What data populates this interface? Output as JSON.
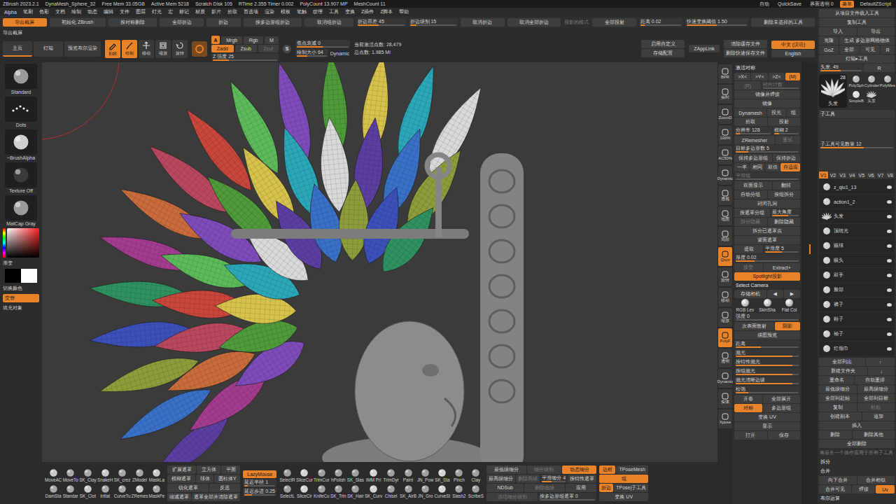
{
  "title_bar": {
    "items": [
      "ZBrush 2023.2.1",
      "DynaMesh_Sphere_32",
      "Free Mem 33.05GB",
      "Active Mem 5218",
      "Scratch Disk 105",
      "RTime 2.355 Timer 0.002",
      "PolyCount 13.907 MP",
      "MeshCount 11"
    ],
    "right": [
      {
        "label": "自动",
        "selected": false
      },
      {
        "label": "QuickSave",
        "selected": false
      },
      {
        "label": "界面透明 0",
        "selected": false
      },
      {
        "label": "菜单",
        "selected": true
      },
      {
        "label": "DefaultZScript",
        "selected": false
      }
    ]
  },
  "menu_bar": [
    "Alpha",
    "笔刷",
    "色彩",
    "文档",
    "绘制",
    "动态",
    "编辑",
    "文件",
    "图层",
    "灯光",
    "宏",
    "标记",
    "材质",
    "影片",
    "拾取",
    "首选项",
    "渲染",
    "模板",
    "笔触",
    "纹理",
    "工具",
    "变换",
    "Z插件",
    "Z脚本",
    "帮助"
  ],
  "shelf_row": [
    {
      "label": "导出截屏",
      "selected": true
    },
    {
      "label": "初始化 ZBrush"
    },
    {
      "label": "按对称删除"
    },
    {
      "label": "全部折边"
    },
    {
      "label": "折边"
    },
    {
      "label": "按多边形组折边"
    },
    {
      "label": "取消组折边"
    },
    {
      "label": "折边容差 45",
      "kind": "slider",
      "level": 0.45
    },
    {
      "label": "折边级别 15",
      "kind": "slider",
      "level": 0.15
    },
    {
      "label": "取消折边"
    },
    {
      "label": "取消全部折边"
    },
    {
      "label": "投影的模式",
      "kind": "text",
      "disabled": true
    },
    {
      "label": "全部投射"
    },
    {
      "label": "距离 0.02",
      "kind": "slider",
      "level": 0.1
    },
    {
      "label": "快速变换阈值 1.50",
      "kind": "slider",
      "level": 0.5
    },
    {
      "label": "删除未选择的工具"
    }
  ],
  "toolbar": {
    "caption": "导出截屏",
    "nav": [
      {
        "label": "主页",
        "selected": true
      },
      {
        "label": "灯箱",
        "selected": false
      },
      {
        "label": "预览布尔渲染",
        "selected": false
      }
    ],
    "modes": [
      {
        "label": "Edit",
        "selected": true
      },
      {
        "label": "绘制",
        "selected": true
      },
      {
        "label": "移动",
        "selected": false
      },
      {
        "label": "缩放",
        "selected": false
      },
      {
        "label": "旋转",
        "selected": false
      }
    ],
    "channel_a": {
      "label": "A",
      "selected": true
    },
    "channels": [
      {
        "label": "Mrgb",
        "selected": false
      },
      {
        "label": "Rgb",
        "selected": false
      },
      {
        "label": "M",
        "selected": false
      }
    ],
    "z_modes": [
      {
        "label": "Zadd",
        "selected": true,
        "disabled": false
      },
      {
        "label": "Zsub",
        "selected": false,
        "disabled": false
      },
      {
        "label": "Zcut",
        "selected": false,
        "disabled": true
      }
    ],
    "z_intensity": {
      "label": "Z 强度 25",
      "level": 0.25
    },
    "s_icon": "S",
    "focal": {
      "label": "焦点衰减 0",
      "level": 0.5
    },
    "draw_size": {
      "label": "绘制大小 64",
      "level": 0.35
    },
    "dynamic": "Dynamic",
    "stats": [
      "当前激活点数: 28,479",
      "总点数: 1.985 Mi"
    ],
    "config": [
      [
        {
          "label": "启用自定义"
        },
        {
          "label": "存储配置"
        }
      ],
      [
        {
          "label": "ZAppLink"
        }
      ],
      [
        {
          "label": "清除缓存文件"
        },
        {
          "label": "删除快速保存文件"
        }
      ],
      [
        {
          "label": "中文 (汉语)",
          "selected": true
        },
        {
          "label": "English",
          "selected": false
        }
      ]
    ]
  },
  "left_tray": {
    "brushes": [
      {
        "label": "Standard"
      },
      {
        "label": "Dots"
      },
      {
        "label": "~BrushAlpha"
      },
      {
        "label": "Texture Off"
      },
      {
        "label": "MatCap Gray"
      }
    ],
    "gradient": "渐变",
    "switch": "切换颜色",
    "alternate": {
      "label": "交替",
      "selected": true
    },
    "fill": "填充对象"
  },
  "shelf_column": [
    {
      "label": "BPR",
      "selected": false
    },
    {
      "label": "实时",
      "selected": false
    },
    {
      "label": "ZoomD",
      "selected": false
    },
    {
      "label": "100%",
      "selected": false
    },
    {
      "label": "AC50%",
      "selected": false
    },
    {
      "label": "Dynamic",
      "selected": false
    },
    {
      "label": "透视",
      "selected": false
    },
    {
      "label": "地面",
      "selected": false
    },
    {
      "label": "局部",
      "selected": false
    },
    {
      "label": "Qxyz",
      "selected": true
    },
    {
      "label": "旋转",
      "selected": false
    },
    {
      "label": "移动",
      "selected": false
    },
    {
      "label": "缩放",
      "selected": false
    },
    {
      "label": "PolyF",
      "selected": true
    },
    {
      "label": "透明",
      "selected": false
    },
    {
      "label": "Dynamic",
      "selected": false
    },
    {
      "label": "实体",
      "selected": false
    },
    {
      "label": "Xpose",
      "selected": false
    }
  ],
  "props_panel": [
    [
      {
        "label": "激活对称",
        "kind": "header"
      }
    ],
    [
      {
        "label": ">X<",
        "selected": false
      },
      {
        "label": ">Y<",
        "selected": false
      },
      {
        "label": ">Z<",
        "selected": false
      },
      {
        "label": "(M)",
        "selected": true
      }
    ],
    [
      {
        "label": "(R)",
        "disabled": true
      },
      {
        "label": "径向计数",
        "kind": "slider",
        "level": 0,
        "disabled": true
      }
    ],
    [
      {
        "label": "镜像并焊接"
      }
    ],
    [
      {
        "label": "镜像"
      }
    ],
    [
      {
        "label": "Dynamesh"
      },
      {
        "label": "投光"
      },
      {
        "label": "组"
      }
    ],
    [
      {
        "label": "拾取"
      },
      {
        "label": "投射"
      }
    ],
    [
      {
        "label": "分辨率 128",
        "kind": "slider",
        "level": 0.13
      },
      {
        "label": "模糊 2",
        "kind": "slider",
        "level": 0.2
      }
    ],
    [
      {
        "label": "ZRemesher"
      },
      {
        "label": "重试",
        "disabled": true
      }
    ],
    [
      {
        "label": "目标多边形数 5",
        "kind": "slider",
        "level": 0.2
      }
    ],
    [
      {
        "label": "保持多边形组"
      },
      {
        "label": "保持折边"
      }
    ],
    [
      {
        "label": "一半",
        "selected": false
      },
      {
        "label": "相同",
        "selected": false
      },
      {
        "label": "双倍",
        "selected": false
      },
      {
        "label": "自适应",
        "selected": true
      }
    ],
    [
      {
        "label": "平滑组",
        "kind": "slider",
        "level": 0,
        "disabled": true
      }
    ],
    [
      {
        "label": "双面显示"
      },
      {
        "label": "翻转"
      }
    ],
    [
      {
        "label": "自动分组"
      },
      {
        "label": "按组拆分"
      }
    ],
    [
      {
        "label": "封闭孔洞"
      }
    ],
    [
      {
        "label": "按遮罩分组"
      },
      {
        "label": "最大角度",
        "kind": "slider",
        "level": 0.6
      }
    ],
    [
      {
        "label": "拆分隐藏",
        "disabled": true
      },
      {
        "label": "删除隐藏"
      }
    ],
    [
      {
        "label": "拆分已遮罩点"
      }
    ],
    [
      {
        "label": "背面遮罩"
      }
    ],
    [
      {
        "label": "提取"
      },
      {
        "label": "平滑度 5",
        "kind": "slider",
        "level": 0.5
      }
    ],
    [
      {
        "label": "厚度 0.02",
        "kind": "slider",
        "level": 0.3
      }
    ],
    [
      {
        "label": "接受",
        "disabled": true
      },
      {
        "label": "Extract+"
      }
    ],
    [
      {
        "label": "Spotlight投影",
        "selected": true
      }
    ],
    [
      {
        "label": "Select Camera",
        "kind": "header"
      }
    ],
    [
      {
        "label": "存储相机"
      },
      {
        "label": "◀"
      },
      {
        "label": "▶"
      }
    ],
    [
      {
        "label": "RGB Lev",
        "kind": "swatch"
      },
      {
        "label": "SkinSha",
        "kind": "swatch"
      },
      {
        "label": "Flat Col",
        "kind": "swatch"
      }
    ],
    [
      {
        "label": "强度 0",
        "kind": "slider",
        "level": 0
      }
    ],
    [
      {
        "label": "次表面散射"
      },
      {
        "label": "阴影",
        "selected": true
      }
    ],
    [
      {
        "label": "描图预览"
      }
    ],
    [
      {
        "label": "距离",
        "kind": "slider",
        "level": 0.4
      }
    ],
    [
      {
        "label": "抛光",
        "kind": "slider",
        "level": 0.9
      }
    ],
    [
      {
        "label": "按特性抛光",
        "kind": "slider",
        "level": 0.9
      }
    ],
    [
      {
        "label": "按组抛光",
        "kind": "slider",
        "level": 0.9
      }
    ],
    [
      {
        "label": "抛光清晰边缘",
        "kind": "slider",
        "level": 0.9
      }
    ],
    [
      {
        "label": "松弛",
        "kind": "slider",
        "level": 0.2
      }
    ],
    [
      {
        "label": "开卷"
      },
      {
        "label": "全部展开"
      }
    ],
    [
      {
        "label": "对称",
        "selected": true
      },
      {
        "label": "多边形组",
        "selected": false
      }
    ],
    [
      {
        "label": "变换 UV"
      }
    ],
    [
      {
        "label": "显示"
      }
    ],
    [
      {
        "label": "打开"
      },
      {
        "label": "保存"
      }
    ]
  ],
  "tool_panel": {
    "top": [
      [
        {
          "label": "从项目文件载入工具"
        }
      ],
      [
        {
          "label": "复制工具"
        }
      ],
      [
        {
          "label": "导入"
        },
        {
          "label": "导出"
        }
      ],
      [
        {
          "label": "克隆"
        },
        {
          "label": "生成 多边形网格物体"
        }
      ],
      [
        {
          "label": "GoZ"
        },
        {
          "label": "全部"
        },
        {
          "label": "可见"
        },
        {
          "label": "R"
        }
      ],
      [
        {
          "label": "灯箱▸工具"
        }
      ],
      [
        {
          "label": "头发. 49",
          "kind": "slider",
          "level": 0.5
        },
        {
          "label": "R"
        }
      ]
    ],
    "current": {
      "name": "头发",
      "count": "28"
    },
    "thumbs": [
      "PolySph",
      "Cylinder",
      "PolyMes",
      "SimpleB",
      "头发"
    ],
    "subtool_header": "子工具",
    "visible_count": {
      "label": "子工具可见数量 12",
      "kind": "slider",
      "level": 0.6
    },
    "versions": [
      {
        "label": "V1",
        "selected": true
      },
      {
        "label": "V2",
        "selected": false
      },
      {
        "label": "V3",
        "selected": false
      },
      {
        "label": "V4",
        "selected": false
      },
      {
        "label": "V5",
        "selected": false
      },
      {
        "label": "V6",
        "selected": false
      },
      {
        "label": "V7",
        "selected": false
      },
      {
        "label": "V8",
        "selected": false
      }
    ],
    "subtools": [
      {
        "name": "z_qiu1_13",
        "visible": true,
        "selected": false
      },
      {
        "name": "action1_2",
        "visible": true,
        "selected": false
      },
      {
        "name": "头发",
        "visible": true,
        "selected": false
      },
      {
        "name": "顶睛光",
        "visible": true,
        "selected": false
      },
      {
        "name": "眼球",
        "visible": true,
        "selected": false
      },
      {
        "name": "眼头",
        "visible": true,
        "selected": false
      },
      {
        "name": "双手",
        "visible": true,
        "selected": false
      },
      {
        "name": "脸部",
        "visible": true,
        "selected": false
      },
      {
        "name": "裤子",
        "visible": true,
        "selected": false
      },
      {
        "name": "鞋子",
        "visible": true,
        "selected": false
      },
      {
        "name": "袖子",
        "visible": true,
        "selected": false
      },
      {
        "name": "红领巾",
        "visible": true,
        "selected": false
      }
    ],
    "actions": [
      [
        {
          "label": "全部列出"
        },
        {
          "label": "↑"
        }
      ],
      [
        {
          "label": "新建文件夹"
        },
        {
          "label": "↓"
        }
      ],
      [
        {
          "label": "重命名"
        },
        {
          "label": "自动重排"
        }
      ],
      [
        {
          "label": "最低级细分"
        },
        {
          "label": "最高级细分"
        }
      ],
      [
        {
          "label": "全部到起始"
        },
        {
          "label": "全部到目标"
        }
      ],
      [
        {
          "label": "复制"
        },
        {
          "label": "粘贴",
          "disabled": true
        }
      ],
      [
        {
          "label": "创建副本"
        },
        {
          "label": "追加"
        }
      ],
      [
        {
          "label": "插入"
        }
      ],
      [
        {
          "label": "删除"
        },
        {
          "label": "删除其他"
        }
      ],
      [
        {
          "label": "全部删除"
        }
      ],
      [
        {
          "label": "将最长一个操作应用于所有子工具",
          "kind": "text",
          "disabled": true
        }
      ],
      [
        {
          "label": "拆分",
          "kind": "header"
        }
      ],
      [
        {
          "label": "合并",
          "kind": "header"
        }
      ],
      [
        {
          "label": "向下合并"
        },
        {
          "label": "合并相似"
        }
      ],
      [
        {
          "label": "合并可见"
        },
        {
          "label": "焊接"
        },
        {
          "label": "Uv",
          "selected": true
        }
      ],
      [
        {
          "label": "布尔运算",
          "kind": "header"
        }
      ]
    ]
  },
  "bottom_shelf": {
    "brushes_a": [
      "MoveAC",
      "MoveTo",
      "SK_Clay",
      "SnakeH",
      "SK_crez",
      "ZModel",
      "MaskLa",
      "DamSta",
      "Standar",
      "SK_Clot",
      "Inflat",
      "CurveTu",
      "ZRemes",
      "MaskPe"
    ],
    "mask_rows": [
      [
        {
          "label": "扩展遮罩"
        },
        {
          "label": "立方体"
        },
        {
          "label": "平面"
        }
      ],
      [
        {
          "label": "模糊遮罩"
        },
        {
          "label": "球体"
        },
        {
          "label": "圆柱体Y"
        }
      ],
      [
        {
          "label": "锐化遮罩"
        },
        {
          "label": "反选"
        }
      ],
      [
        {
          "label": "缩减遮罩"
        },
        {
          "label": "遮罩全部并清除遮罩"
        }
      ]
    ],
    "lazy_rows": [
      [
        {
          "label": "LazyMouse",
          "selected": true
        }
      ],
      [
        {
          "label": "延迟半径 1",
          "kind": "slider",
          "level": 0.1
        }
      ],
      [
        {
          "label": "延迟步进 0.25",
          "kind": "slider",
          "level": 0.25
        }
      ]
    ],
    "brushes_b": [
      "SelectR",
      "SliceCur",
      "TrimCur",
      "hPolish",
      "SK_Slas",
      "IMM Pri",
      "TrimDyr",
      "Paint",
      "JN_Pow",
      "SK_Sta",
      "Pinch",
      "Clay",
      "SelectL",
      "SliceCir",
      "KnifeCu",
      "SK_Trin",
      "SK_Hair",
      "SK_Curv",
      "Chisel",
      "SK_AirB",
      "JN_Gro",
      "CurveSt",
      "Slash2",
      "ScribeS"
    ],
    "subdiv_rows": [
      [
        {
          "label": "最低级细分"
        },
        {
          "label": "细分级别",
          "disabled": true
        },
        {
          "label": "动态细分",
          "selected": true
        }
      ],
      [
        {
          "label": "最高级细分"
        },
        {
          "label": "删除高级",
          "disabled": true
        },
        {
          "label": "平滑细分 4",
          "kind": "slider",
          "level": 0.4
        },
        {
          "label": "按特性遮罩"
        }
      ],
      [
        {
          "label": "NDSub"
        },
        {
          "label": "删除低级",
          "disabled": true
        },
        {
          "label": "应用"
        }
      ],
      [
        {
          "label": "冻结细分级别",
          "disabled": true
        },
        {
          "label": "按多边形组遮罩 0",
          "kind": "slider",
          "level": 0
        }
      ]
    ],
    "edge_rows": [
      [
        {
          "label": "边框",
          "selected": true
        },
        {
          "label": "TPoseMesh"
        }
      ],
      [
        {
          "label": "组",
          "selected": true
        }
      ],
      [
        {
          "label": "折边",
          "selected": true
        },
        {
          "label": "TPose|子工具"
        }
      ],
      [
        {
          "label": "变换 UV"
        }
      ]
    ]
  }
}
